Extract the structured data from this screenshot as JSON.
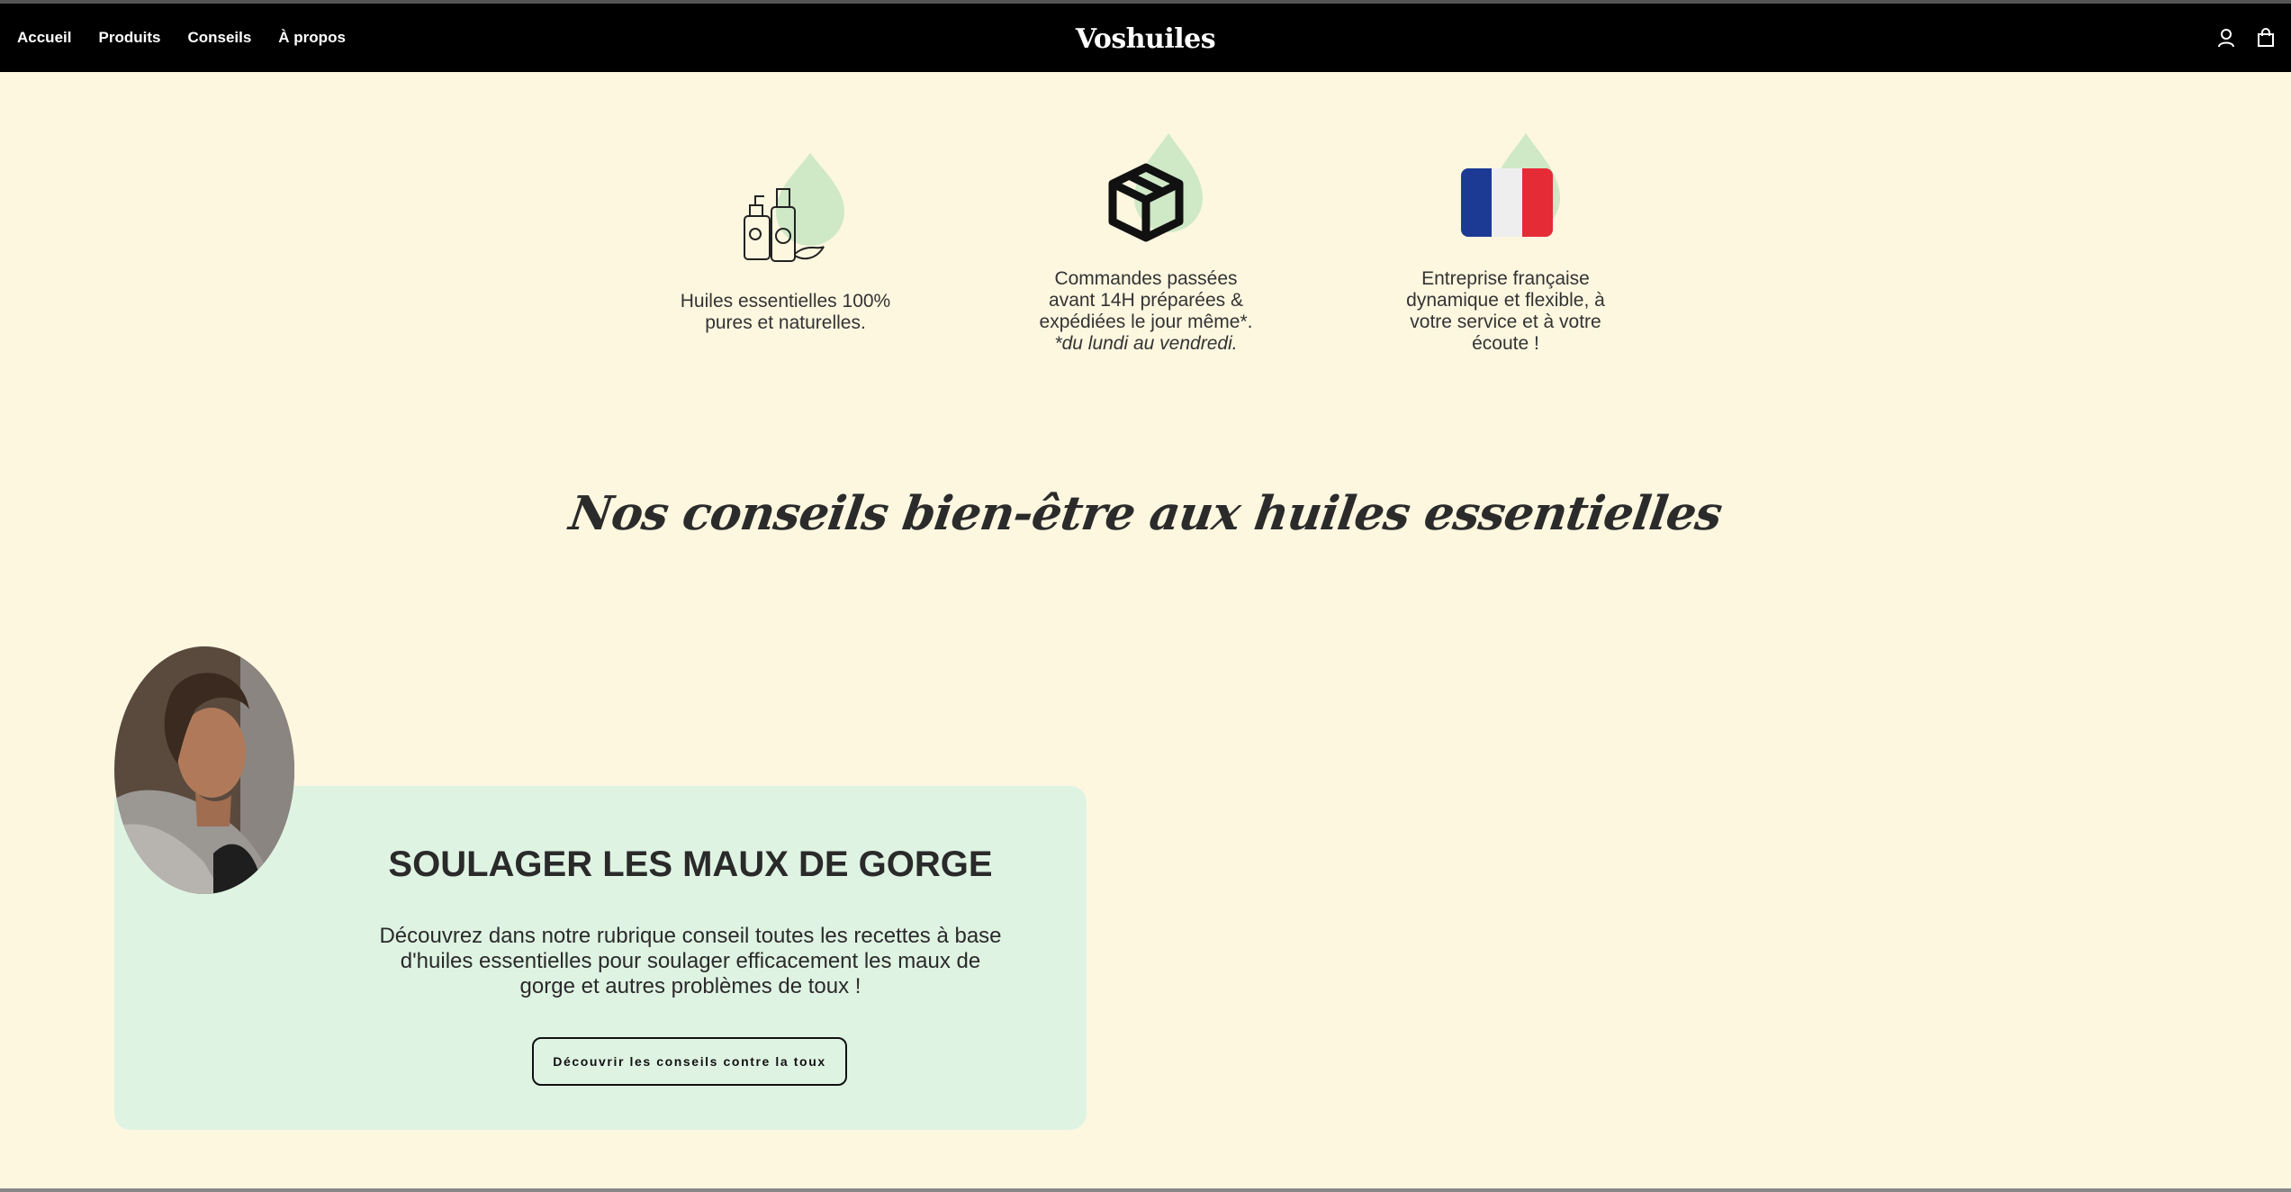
{
  "nav": {
    "links": [
      "Accueil",
      "Produits",
      "Conseils",
      "À propos"
    ],
    "brand": "Voshuiles",
    "icons": [
      "account-icon",
      "cart-icon"
    ]
  },
  "features": [
    {
      "icon": "essential-oil-bottles-icon",
      "lines": [
        "Huiles essentielles 100%",
        "pures et naturelles."
      ]
    },
    {
      "icon": "package-box-icon",
      "lines": [
        "Commandes passées",
        "avant 14H préparées &",
        "expédiées le jour même*."
      ],
      "note": "*du lundi au vendredi."
    },
    {
      "icon": "france-flag-icon",
      "lines": [
        "Entreprise française",
        "dynamique et flexible, à",
        "votre service et à votre",
        "écoute !"
      ]
    }
  ],
  "section_title": "Nos conseils bien-être aux huiles essentielles",
  "card": {
    "title": "SOULAGER LES MAUX DE GORGE",
    "description_lines": [
      "Découvrez dans notre rubrique conseil toutes les recettes à base",
      "d'huiles essentielles pour soulager efficacement les maux de",
      "gorge et autres problèmes de toux !"
    ],
    "button": "Découvrir les conseils contre la toux"
  },
  "colors": {
    "page_bg": "#fdf7e0",
    "nav_bg": "#000000",
    "card_bg": "#dff3e3",
    "drop_green": "#cfe8c6"
  }
}
